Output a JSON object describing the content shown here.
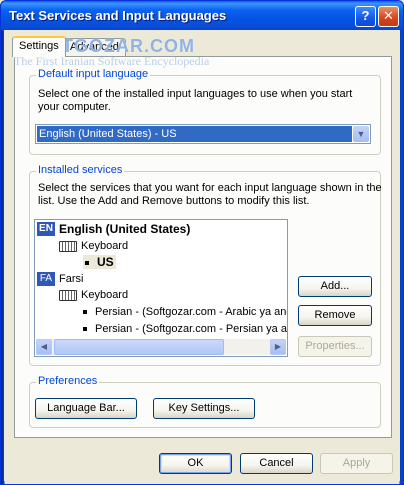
{
  "window": {
    "title": "Text Services and Input Languages",
    "help_label": "?",
    "close_label": "✕"
  },
  "watermark": {
    "brand": "SOFTGOZAR.COM",
    "subtitle": "The First Iranian Software Encyclopedia"
  },
  "tabs": [
    {
      "label": "Settings",
      "selected": true
    },
    {
      "label": "Advanced",
      "selected": false
    }
  ],
  "default_language": {
    "group_title": "Default input language",
    "description": "Select one of the installed input languages to use when you start your computer.",
    "selected": "English (United States) - US"
  },
  "installed_services": {
    "group_title": "Installed services",
    "description": "Select the services that you want for each input language shown in the list. Use the Add and Remove buttons to modify this list.",
    "tree": {
      "en": {
        "badge": "EN",
        "name": "English (United States)",
        "category": "Keyboard",
        "layouts": [
          "US"
        ]
      },
      "fa": {
        "badge": "FA",
        "name": "Farsi",
        "category": "Keyboard",
        "layouts": [
          "Persian - (Softgozar.com - Arabic ya and",
          "Persian - (Softgozar.com - Persian ya and"
        ]
      }
    },
    "buttons": {
      "add": "Add...",
      "remove": "Remove",
      "properties": "Properties..."
    }
  },
  "preferences": {
    "group_title": "Preferences",
    "language_bar": "Language Bar...",
    "key_settings": "Key Settings..."
  },
  "footer": {
    "ok": "OK",
    "cancel": "Cancel",
    "apply": "Apply"
  },
  "colors": {
    "title_bar": "#0554e3",
    "group_title": "#0046d5",
    "selection": "#316ac5",
    "lang_badge": "#2e57b8"
  }
}
